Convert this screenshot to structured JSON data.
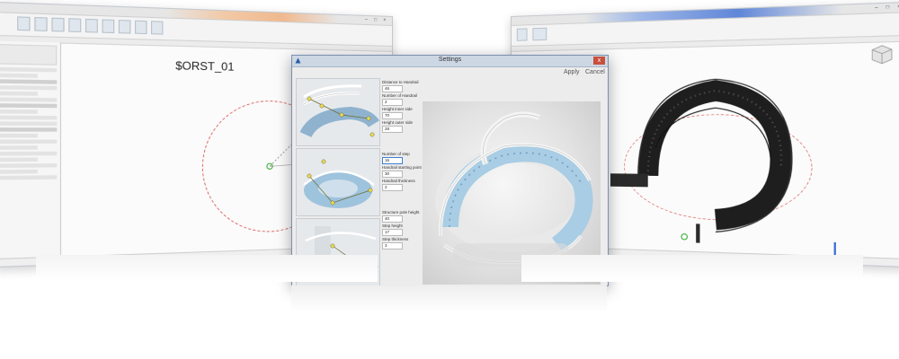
{
  "colors": {
    "dialog_title_bg": "#cdd7e4",
    "close_button": "#c94f3d",
    "glass_step": "#9ec3dd",
    "handle_yellow": "#e8d84a",
    "dark_stair": "#2b2b2b"
  },
  "left_window": {
    "view_title": "$ORST_01"
  },
  "dialog": {
    "title": "Settings",
    "apply_label": "Apply",
    "cancel_label": "Cancel",
    "close_glyph": "x",
    "fields": [
      {
        "label": "Distance to Handrail",
        "value": "46"
      },
      {
        "label": "Number of Handrail",
        "value": "2"
      },
      {
        "label": "Height inner side",
        "value": "70"
      },
      {
        "label": "Height outer side",
        "value": "28"
      },
      {
        "label": "Number of step",
        "value": "16"
      },
      {
        "label": "Handrail starting point",
        "value": "30"
      },
      {
        "label": "Handrail thickness",
        "value": "2"
      },
      {
        "label": "Structure pole height",
        "value": "40"
      },
      {
        "label": "Step height",
        "value": "17"
      },
      {
        "label": "Step thickness",
        "value": "3"
      }
    ]
  },
  "icons": [
    "app-icon",
    "close-icon",
    "navigation-cube-icon"
  ]
}
